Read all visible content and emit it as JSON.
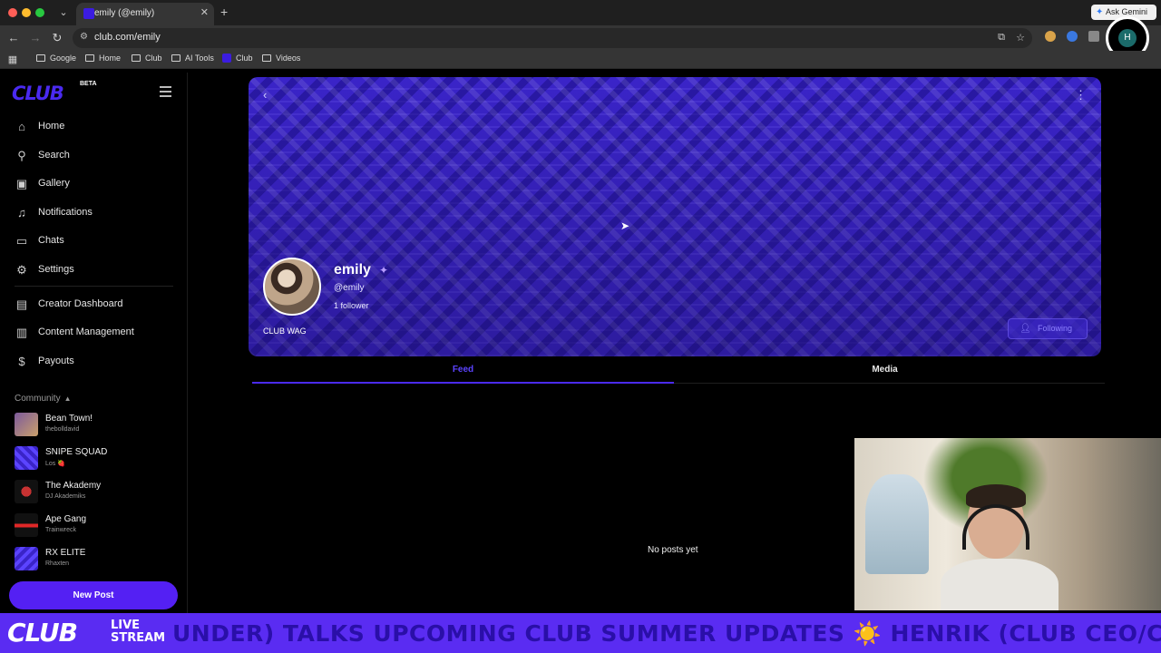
{
  "browser": {
    "tab_title": "emily (@emily)",
    "url": "club.com/emily",
    "gemini_label": "Ask Gemini",
    "profile_initial": "H",
    "bookmarks": [
      {
        "label": "Google",
        "icon": "folder-icon"
      },
      {
        "label": "Home",
        "icon": "folder-icon"
      },
      {
        "label": "Club",
        "icon": "folder-icon"
      },
      {
        "label": "AI Tools",
        "icon": "folder-icon"
      },
      {
        "label": "Club",
        "icon": "club-favicon"
      },
      {
        "label": "Videos",
        "icon": "folder-icon"
      }
    ]
  },
  "sidebar": {
    "logo": "CLUB",
    "logo_badge": "BETA",
    "nav": [
      {
        "label": "Home",
        "icon": "home-icon"
      },
      {
        "label": "Search",
        "icon": "search-icon"
      },
      {
        "label": "Gallery",
        "icon": "gallery-icon"
      },
      {
        "label": "Notifications",
        "icon": "bell-icon"
      },
      {
        "label": "Chats",
        "icon": "chat-icon"
      },
      {
        "label": "Settings",
        "icon": "gear-icon"
      },
      {
        "label": "Creator Dashboard",
        "icon": "dashboard-icon"
      },
      {
        "label": "Content Management",
        "icon": "content-icon"
      },
      {
        "label": "Payouts",
        "icon": "dollar-icon"
      }
    ],
    "community_header": "Community",
    "communities": [
      {
        "name": "Bean Town!",
        "owner": "thebolldavid"
      },
      {
        "name": "SNIPE SQUAD",
        "owner": "Los 🍓"
      },
      {
        "name": "The Akademy",
        "owner": "DJ Akademiks"
      },
      {
        "name": "Ape Gang",
        "owner": "Trainwreck"
      },
      {
        "name": "RX ELITE",
        "owner": "Rhaxten"
      }
    ],
    "new_post_label": "New Post"
  },
  "profile": {
    "name": "emily",
    "handle": "@emily",
    "followers": "1 follower",
    "club_label": "CLUB WAG",
    "following_label": "Following"
  },
  "tabs": {
    "feed": "Feed",
    "media": "Media"
  },
  "feed": {
    "empty_message": "No posts yet"
  },
  "ticker": {
    "logo": "CLUB",
    "live_line1": "LIVE",
    "live_line2": "STREAM",
    "scroll_text": "UNDER) TALKS UPCOMING CLUB SUMMER UPDATES ☀️ HENRIK (CLUB CEO/CO-FO"
  },
  "colors": {
    "accent": "#5420f3",
    "banner": "#3a24c8",
    "ticker_bg": "#5a2cf2"
  }
}
